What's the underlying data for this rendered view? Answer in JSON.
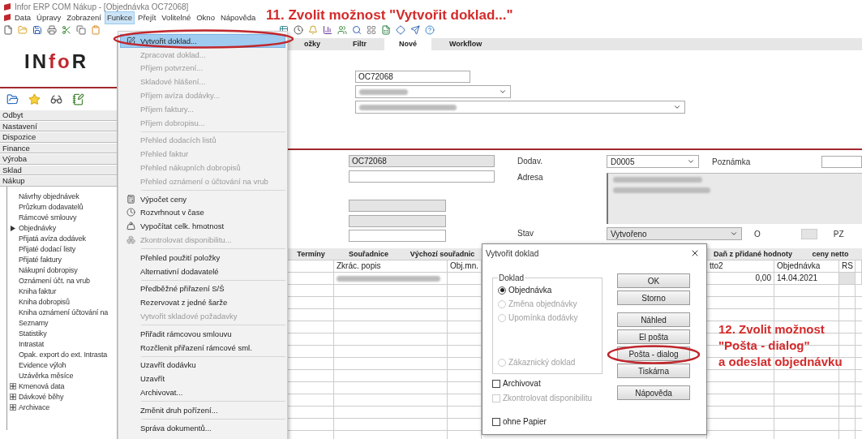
{
  "window": {
    "title": "Infor ERP COM Nákup - [Objednávka OC72068]"
  },
  "menubar": [
    {
      "label": "Data",
      "selected": false
    },
    {
      "label": "Úpravy",
      "selected": false
    },
    {
      "label": "Zobrazení",
      "selected": false
    },
    {
      "label": "Funkce",
      "selected": true
    },
    {
      "label": "Přejít",
      "selected": false
    },
    {
      "label": "Volitelné",
      "selected": false
    },
    {
      "label": "Okno",
      "selected": false
    },
    {
      "label": "Nápověda",
      "selected": false
    }
  ],
  "sidebar": {
    "logo": [
      {
        "text": "IN",
        "accent": false
      },
      {
        "text": "fo",
        "accent": true
      },
      {
        "text": "R",
        "accent": false
      }
    ],
    "sections": [
      {
        "label": "Odbyt"
      },
      {
        "label": "Nastavení"
      },
      {
        "label": "Dispozice"
      },
      {
        "label": "Finance"
      },
      {
        "label": "Výroba"
      },
      {
        "label": "Sklad"
      },
      {
        "label": "Nákup",
        "children": [
          {
            "label": "Návrhy objednávek",
            "kind": "leaf"
          },
          {
            "label": "Průzkum dodavatelů",
            "kind": "leaf"
          },
          {
            "label": "Rámcové smlouvy",
            "kind": "leaf"
          },
          {
            "label": "Objednávky",
            "kind": "branch"
          },
          {
            "label": "Přijatá avíza dodávek",
            "kind": "leaf"
          },
          {
            "label": "Přijaté dodací listy",
            "kind": "leaf"
          },
          {
            "label": "Přijaté faktury",
            "kind": "leaf"
          },
          {
            "label": "Nákupní dobropisy",
            "kind": "leaf"
          },
          {
            "label": "Oznámení účt. na vrub",
            "kind": "leaf"
          },
          {
            "label": "Kniha faktur",
            "kind": "leaf"
          },
          {
            "label": "Kniha dobropisů",
            "kind": "leaf"
          },
          {
            "label": "Kniha oznámení účtování na",
            "kind": "leaf"
          },
          {
            "label": "Seznamy",
            "kind": "leaf"
          },
          {
            "label": "Statistiky",
            "kind": "leaf"
          },
          {
            "label": "Intrastat",
            "kind": "leaf"
          },
          {
            "label": "Opak. export do ext. Intrasta",
            "kind": "leaf"
          },
          {
            "label": "Evidence výloh",
            "kind": "leaf"
          },
          {
            "label": "Uzávěrka měsíce",
            "kind": "leaf"
          },
          {
            "label": "Kmenová data",
            "kind": "group"
          },
          {
            "label": "Dávkové běhy",
            "kind": "group"
          },
          {
            "label": "Archivace",
            "kind": "group"
          }
        ]
      }
    ]
  },
  "menu": {
    "sections": [
      [
        {
          "label": "Vytvořit doklad...",
          "kind": "edit",
          "selected": true,
          "disabled": false
        },
        {
          "label": "Zpracovat doklad...",
          "kind": "plain",
          "selected": false,
          "disabled": true
        },
        {
          "label": "Příjem potvrzení...",
          "kind": "plain",
          "selected": false,
          "disabled": true
        },
        {
          "label": "Skladové hlášení...",
          "kind": "plain",
          "selected": false,
          "disabled": true
        },
        {
          "label": "Příjem avíza dodávky...",
          "kind": "plain",
          "selected": false,
          "disabled": true
        },
        {
          "label": "Příjem faktury...",
          "kind": "plain",
          "selected": false,
          "disabled": true
        },
        {
          "label": "Příjem dobropisu...",
          "kind": "plain",
          "selected": false,
          "disabled": true
        }
      ],
      [
        {
          "label": "Přehled dodacích listů",
          "kind": "plain",
          "selected": false,
          "disabled": true
        },
        {
          "label": "Přehled faktur",
          "kind": "plain",
          "selected": false,
          "disabled": true
        },
        {
          "label": "Přehled nákupních dobropisů",
          "kind": "plain",
          "selected": false,
          "disabled": true
        },
        {
          "label": "Přehled oznámení o účtování na vrub",
          "kind": "plain",
          "selected": false,
          "disabled": true
        }
      ],
      [
        {
          "label": "Výpočet ceny",
          "kind": "calculator",
          "selected": false,
          "disabled": false
        },
        {
          "label": "Rozvrhnout v čase",
          "kind": "clock",
          "selected": false,
          "disabled": false
        },
        {
          "label": "Vypočítat celk. hmotnost",
          "kind": "weight",
          "selected": false,
          "disabled": false
        },
        {
          "label": "Zkontrolovat disponibilitu...",
          "kind": "boxes",
          "selected": false,
          "disabled": true
        }
      ],
      [
        {
          "label": "Přehled použití položky",
          "kind": "plain",
          "selected": false,
          "disabled": false
        },
        {
          "label": "Alternativní dodavatelé",
          "kind": "plain",
          "selected": false,
          "disabled": false
        }
      ],
      [
        {
          "label": "Předběžné přiřazení S/Š",
          "kind": "plain",
          "selected": false,
          "disabled": false
        },
        {
          "label": "Rezervovat z jedné šarže",
          "kind": "plain",
          "selected": false,
          "disabled": false
        },
        {
          "label": "Vytvořit skladové požadavky",
          "kind": "plain",
          "selected": false,
          "disabled": true
        }
      ],
      [
        {
          "label": "Přiřadit rámcovou smlouvu",
          "kind": "plain",
          "selected": false,
          "disabled": false
        },
        {
          "label": "Rozčlenit přiřazení rámcové sml.",
          "kind": "plain",
          "selected": false,
          "disabled": false
        }
      ],
      [
        {
          "label": "Uzavřít dodávku",
          "kind": "plain",
          "selected": false,
          "disabled": false
        },
        {
          "label": "Uzavřít",
          "kind": "plain",
          "selected": false,
          "disabled": false
        },
        {
          "label": "Archivovat...",
          "kind": "plain",
          "selected": false,
          "disabled": false
        }
      ],
      [
        {
          "label": "Změnit druh pořízení...",
          "kind": "plain",
          "selected": false,
          "disabled": false
        }
      ],
      [
        {
          "label": "Správa dokumentů...",
          "kind": "plain",
          "selected": false,
          "disabled": false
        }
      ]
    ]
  },
  "main": {
    "tabs": [
      {
        "label": "ožky",
        "selected": false
      },
      {
        "label": "Filtr",
        "selected": false
      },
      {
        "label": "Nové",
        "selected": true
      },
      {
        "label": "Workflow",
        "selected": false
      }
    ],
    "header_form": {
      "order_number": "OC72068"
    },
    "detail_form": {
      "order_number": "OC72068",
      "supplier_label": "Dodav.",
      "supplier": "D0005",
      "note_label": "Poznámka",
      "address_label": "Adresa",
      "status_label": "Stav",
      "status": "Vytvořeno",
      "o_label": "O",
      "pz_label": "PZ"
    },
    "table": {
      "tabs": [
        "Termíny",
        "Souřadnice",
        "Výchozí souřadnic",
        "Daň z přidané hodnoty",
        "ceny netto"
      ],
      "columns": [
        "Zkrác. popis",
        "Obj.mn.",
        "tto2",
        "Objednávka",
        "RS"
      ],
      "rows": [
        {
          "values": [
            "0,00",
            "14.04.2021"
          ]
        }
      ]
    }
  },
  "dialog": {
    "title": "Vytvořit doklad",
    "group": {
      "title": "Doklad",
      "options": [
        {
          "label": "Objednávka",
          "selected": true,
          "disabled": false
        },
        {
          "label": "Změna objednávky",
          "selected": false,
          "disabled": true
        },
        {
          "label": "Upomínka dodávky",
          "selected": false,
          "disabled": true
        },
        {
          "label": "Zákaznický doklad",
          "selected": false,
          "disabled": true
        }
      ]
    },
    "checkboxes": [
      {
        "label": "Archivovat",
        "checked": false,
        "disabled": false
      },
      {
        "label": "Zkontrolovat disponibilitu",
        "checked": false,
        "disabled": true
      },
      {
        "label": "ohne Papier",
        "checked": false,
        "disabled": false
      }
    ],
    "buttons": [
      [
        "OK",
        "Storno"
      ],
      [
        "Náhled",
        "El pošta",
        "Pošta - dialog",
        "Tiskárna"
      ],
      [
        "Nápověda"
      ]
    ]
  },
  "annotations": [
    {
      "lines": [
        "11. Zvolit možnost \"Vytvořit doklad...\""
      ]
    },
    {
      "lines": [
        "12. Zvolit možnost",
        "\"Pošta - dialog\"",
        "a odeslat objednávku"
      ]
    }
  ]
}
